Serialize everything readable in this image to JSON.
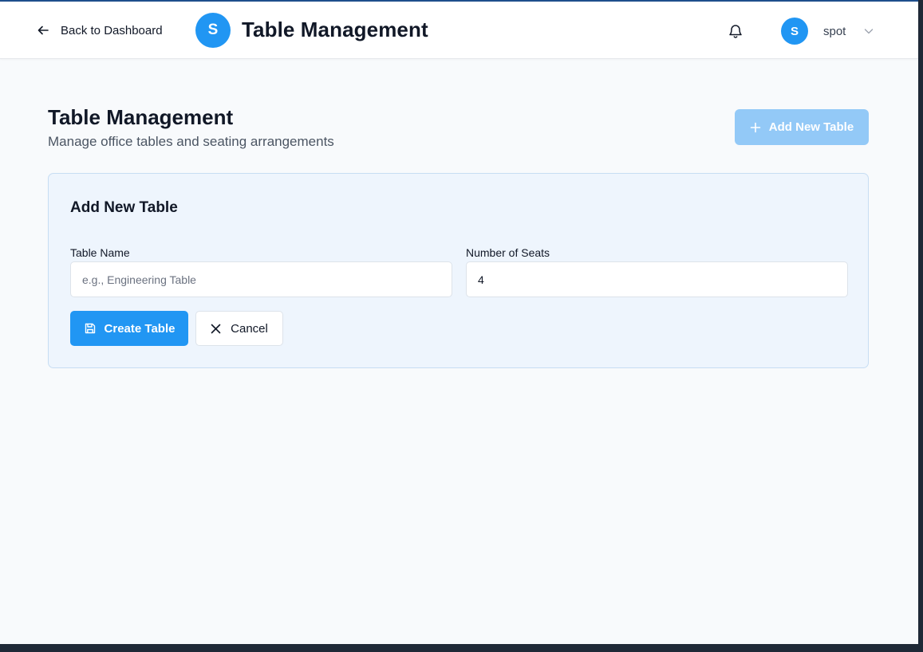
{
  "header": {
    "back_label": "Back to Dashboard",
    "brand_initial": "S",
    "app_title": "Table Management",
    "user": {
      "initial": "S",
      "name": "spot"
    }
  },
  "page": {
    "title": "Table Management",
    "subtitle": "Manage office tables and seating arrangements",
    "add_button_label": "Add New Table"
  },
  "form": {
    "title": "Add New Table",
    "table_name": {
      "label": "Table Name",
      "placeholder": "e.g., Engineering Table",
      "value": ""
    },
    "seats": {
      "label": "Number of Seats",
      "value": "4"
    },
    "create_label": "Create Table",
    "cancel_label": "Cancel"
  },
  "icons": {
    "back": "arrow-left-icon",
    "notifications": "bell-icon",
    "user_menu": "chevron-down-icon",
    "add": "plus-icon",
    "create": "save-icon",
    "cancel": "close-icon"
  },
  "colors": {
    "accent": "#2196f3",
    "accent_disabled": "#93c9f7",
    "card_bg": "#eef5fd",
    "page_bg": "#f8fafc"
  }
}
